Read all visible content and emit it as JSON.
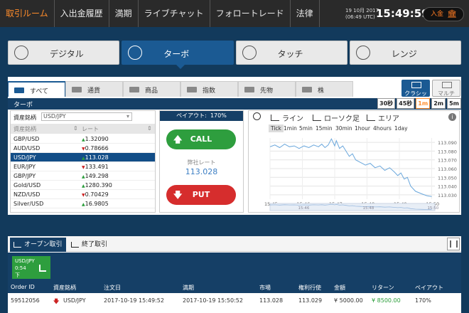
{
  "nav": {
    "items": [
      "取引ルーム",
      "入出金履歴",
      "満期",
      "ライブチャット",
      "フォロートレード",
      "法律"
    ],
    "active_index": 0,
    "date_line1": "19 10月 2017",
    "date_line2": "(06:49 UTC)",
    "clock": "15:49:59",
    "deposit_label": "入金",
    "deposit_icon": "bank-icon"
  },
  "modes": [
    {
      "label": "デジタル",
      "icon": "tree-icon",
      "active": false
    },
    {
      "label": "ターボ",
      "icon": "clock-icon",
      "active": true
    },
    {
      "label": "タッチ",
      "icon": "target-icon",
      "active": false
    },
    {
      "label": "レンジ",
      "icon": "range-icon",
      "active": false
    }
  ],
  "categories": [
    {
      "label": "すべて",
      "icon": "clock-icon"
    },
    {
      "label": "通貨",
      "icon": "currency-icon"
    },
    {
      "label": "商品",
      "icon": "commodity-icon"
    },
    {
      "label": "指数",
      "icon": "index-icon"
    },
    {
      "label": "先物",
      "icon": "futures-icon"
    },
    {
      "label": "株",
      "icon": "stock-icon"
    }
  ],
  "views": {
    "classic": "クラシック",
    "multi": "マルチ"
  },
  "subbar": {
    "title": "ターボ",
    "timeframes": [
      "30秒",
      "45秒",
      "1m",
      "2m",
      "5m"
    ],
    "active_timeframe": 2
  },
  "assets": {
    "select_label": "資産銘柄",
    "dropdown_value": "USD/JPY",
    "col_name": "資産銘柄",
    "col_rate": "レート",
    "rows": [
      {
        "name": "GBP/USD",
        "rate": "1.32090",
        "dir": "up"
      },
      {
        "name": "AUD/USD",
        "rate": "0.78666",
        "dir": "down"
      },
      {
        "name": "USD/JPY",
        "rate": "113.028",
        "dir": "up",
        "selected": true
      },
      {
        "name": "EUR/JPY",
        "rate": "133.491",
        "dir": "down"
      },
      {
        "name": "GBP/JPY",
        "rate": "149.298",
        "dir": "up"
      },
      {
        "name": "Gold/USD",
        "rate": "1280.390",
        "dir": "up"
      },
      {
        "name": "NZD/USD",
        "rate": "0.70429",
        "dir": "down"
      },
      {
        "name": "Silver/USD",
        "rate": "16.9805",
        "dir": "up"
      }
    ]
  },
  "trade": {
    "payout_label": "ペイアウト:",
    "payout_value": "170%",
    "call_label": "CALL",
    "put_label": "PUT",
    "rate_label": "弊社レート",
    "rate_value": "113.028"
  },
  "chart_controls": {
    "types": [
      "ライン",
      "ローソク足",
      "エリア"
    ],
    "intervals": [
      "Tick",
      "1min",
      "5min",
      "15min",
      "30min",
      "1hour",
      "4hours",
      "1day"
    ],
    "active_interval": 0
  },
  "chart_data": {
    "type": "line",
    "title": "",
    "xlabel": "",
    "ylabel": "",
    "x_ticks": [
      "15:45",
      "15:46",
      "15:47",
      "15:48",
      "15:49",
      "15:50"
    ],
    "y_ticks": [
      "113.090",
      "113.080",
      "113.070",
      "113.060",
      "113.050",
      "113.040",
      "113.030"
    ],
    "xlim_min": [
      45,
      50.1
    ],
    "ylim": [
      113.025,
      113.095
    ],
    "navigator_ticks": [
      "15:46",
      "15:48",
      "15:50"
    ],
    "series": [
      {
        "x": [
          45.0,
          45.15,
          45.3,
          45.45,
          45.6,
          45.75,
          45.9,
          46.05,
          46.2,
          46.35,
          46.5,
          46.6,
          46.7,
          46.8,
          46.9,
          47.0,
          47.05,
          47.15,
          47.25,
          47.35,
          47.45,
          47.55,
          47.65,
          47.8,
          47.95,
          48.1,
          48.25,
          48.4,
          48.55,
          48.7,
          48.85,
          48.95,
          49.05,
          49.15,
          49.25,
          49.35,
          49.5,
          49.7,
          49.85,
          50.0
        ],
        "y": [
          113.085,
          113.087,
          113.084,
          113.088,
          113.085,
          113.086,
          113.083,
          113.086,
          113.084,
          113.087,
          113.085,
          113.088,
          113.084,
          113.087,
          113.094,
          113.086,
          113.092,
          113.083,
          113.086,
          113.08,
          113.074,
          113.077,
          113.07,
          113.067,
          113.064,
          113.066,
          113.061,
          113.063,
          113.058,
          113.061,
          113.056,
          113.052,
          113.055,
          113.048,
          113.05,
          113.04,
          113.034,
          113.031,
          113.029,
          113.028
        ]
      }
    ]
  },
  "bottom": {
    "tab_open": "オープン取引",
    "tab_closed": "終了取引",
    "mini": {
      "asset": "USD/JPY",
      "time": "0:54",
      "flag": "下"
    },
    "columns": [
      "Order ID",
      "資産銘柄",
      "注文日",
      "満期",
      "市場",
      "権利行使",
      "金額",
      "リターン",
      "ペイアウト"
    ],
    "rows": [
      {
        "order_id": "59512056",
        "asset": "USD/JPY",
        "dir": "down",
        "order_date": "2017-10-19 15:49:52",
        "expiry": "2017-10-19 15:50:52",
        "market": "113.028",
        "strike": "113.029",
        "amount": "¥ 5000.00",
        "return": "¥ 8500.00",
        "payout": "170%"
      }
    ]
  }
}
